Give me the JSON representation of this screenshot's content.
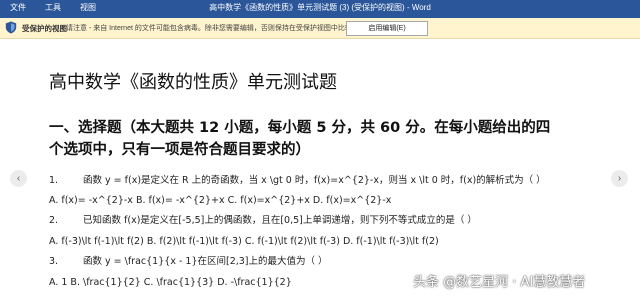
{
  "titlebar": {
    "menu": [
      "文件",
      "工具",
      "视图"
    ],
    "title": "高中数学《函数的性质》单元测试题 (3) (受保护的视图) - Word"
  },
  "protected_view": {
    "title": "受保护的视图",
    "message": "请注意 - 来自 Internet 的文件可能包含病毒。除非您需要编辑，否则保持在受保护视图中比较安全。",
    "button": "启用编辑(E)"
  },
  "document": {
    "heading": "高中数学《函数的性质》单元测试题",
    "section_line1": "一、选择题（本大题共 12 小题，每小题 5 分，共 60 分。在每小题给出的四",
    "section_line2": "个选项中，只有一项是符合题目要求的）",
    "questions": [
      {
        "num": "1.",
        "text": "函数 y = f(x)是定义在 R 上的奇函数，当 x \\gt 0 时，f(x)=x^{2}-x，则当 x \\lt 0 时，f(x)的解析式为（  ）",
        "options": "A. f(x)= -x^{2}-x  B. f(x)= -x^{2}+x  C. f(x)=x^{2}+x  D. f(x)=x^{2}-x"
      },
      {
        "num": "2.",
        "text": "已知函数 f(x)是定义在[-5,5]上的偶函数，且在[0,5]上单调递增，则下列不等式成立的是（  ）",
        "options": "A. f(-3)\\lt f(-1)\\lt f(2)  B. f(2)\\lt f(-1)\\lt f(-3)  C. f(-1)\\lt f(2)\\lt f(-3)  D. f(-1)\\lt f(-3)\\lt f(2)"
      },
      {
        "num": "3.",
        "text": "函数 y = \\frac{1}{x - 1}在区间[2,3]上的最大值为（  ）",
        "options": "A. 1  B. \\frac{1}{2}  C. \\frac{1}{3}  D. -\\frac{1}{2}"
      }
    ]
  },
  "watermark": "头条 @数艺星河 · AI慧教慧者",
  "nav": {
    "prev": "‹",
    "next": "›"
  }
}
